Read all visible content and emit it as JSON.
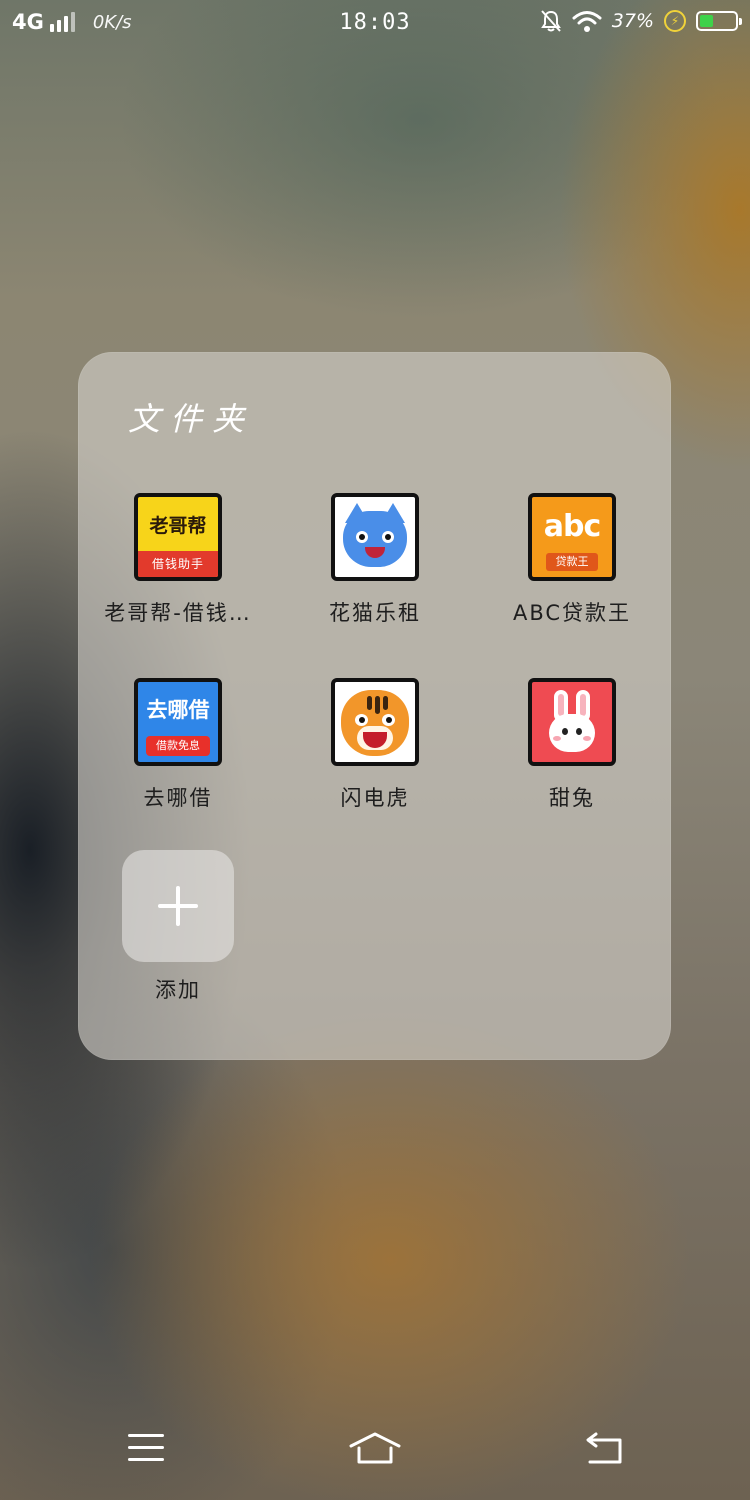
{
  "status_bar": {
    "network_type": "4G",
    "network_speed": "0K/s",
    "time": "18:03",
    "battery_percent": "37%",
    "battery_level": 0.37,
    "icons": [
      "signal-icon",
      "mute-bell-icon",
      "wifi-icon",
      "charging-icon",
      "battery-icon"
    ]
  },
  "folder": {
    "title": "文件夹",
    "apps": [
      {
        "label": "老哥帮-借钱…",
        "icon_text": "老哥帮",
        "icon_subtext": "借钱助手",
        "icon": "laogebang-app-icon"
      },
      {
        "label": "花猫乐租",
        "icon": "blue-cat-app-icon"
      },
      {
        "label": "ABC贷款王",
        "icon_text": "abc",
        "icon_subtext": "贷款王",
        "icon": "abc-loan-app-icon"
      },
      {
        "label": "去哪借",
        "icon_text": "去哪借",
        "icon_subtext": "借款免息",
        "icon": "qunajie-app-icon"
      },
      {
        "label": "闪电虎",
        "icon": "tiger-app-icon"
      },
      {
        "label": "甜兔",
        "icon": "rabbit-app-icon"
      }
    ],
    "add_label": "添加"
  },
  "nav_bar": {
    "icons": [
      "menu-icon",
      "home-icon",
      "back-icon"
    ]
  },
  "colors": {
    "folder_bg": "#d2cec8",
    "battery_fill": "#3ed24a",
    "charging": "#f0d23a"
  }
}
